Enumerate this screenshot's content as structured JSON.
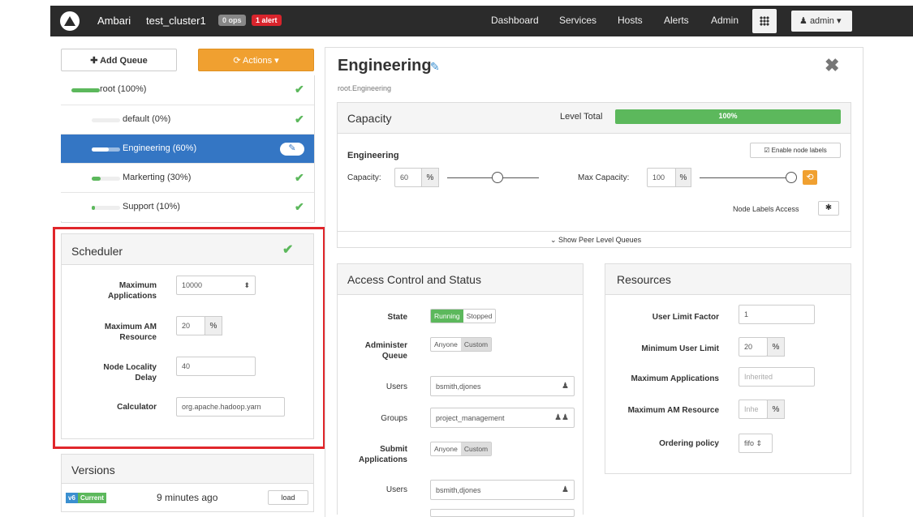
{
  "topbar": {
    "brand": "Ambari",
    "cluster": "test_cluster1",
    "ops_badge": "0 ops",
    "alert_badge": "1 alert",
    "nav": [
      "Dashboard",
      "Services",
      "Hosts",
      "Alerts",
      "Admin"
    ],
    "user_label": "admin ▾"
  },
  "left": {
    "add_queue": "✚ Add Queue",
    "actions": "⟳ Actions ▾",
    "queues": [
      {
        "label": "root (100%)",
        "percent": 100,
        "status": "ok"
      },
      {
        "label": "default (0%)",
        "percent": 0,
        "status": "ok"
      },
      {
        "label": "Engineering (60%)",
        "percent": 60,
        "status": "editing"
      },
      {
        "label": "Markerting (30%)",
        "percent": 30,
        "status": "ok"
      },
      {
        "label": "Support (10%)",
        "percent": 10,
        "status": "ok"
      }
    ]
  },
  "scheduler": {
    "title": "Scheduler",
    "max_apps_label": "Maximum Applications",
    "max_apps_value": "10000",
    "max_am_label": "Maximum AM Resource",
    "max_am_value": "20",
    "percent": "%",
    "node_locality_label": "Node Locality Delay",
    "node_locality_value": "40",
    "calculator_label": "Calculator",
    "calculator_value": "org.apache.hadoop.yarn"
  },
  "versions": {
    "title": "Versions",
    "tag_v": "v6",
    "tag_current": "Current",
    "time": "9 minutes ago",
    "load": "load"
  },
  "queue": {
    "title": "Engineering",
    "path": "root.Engineering"
  },
  "capacity": {
    "title": "Capacity",
    "level_total_label": "Level Total",
    "level_total_text": "100%",
    "level_total": 100,
    "queue_name": "Engineering",
    "enable_labels": "☑ Enable node labels",
    "capacity_label": "Capacity:",
    "capacity_value": "60",
    "capacity_level": 0.55,
    "max_capacity_label": "Max Capacity:",
    "max_capacity_value": "100",
    "max_capacity_level": 1.0,
    "percent": "%",
    "node_labels_access": "Node Labels Access",
    "show_peer": "⌄ Show Peer Level Queues"
  },
  "access": {
    "title": "Access Control and Status",
    "state_label": "State",
    "running": "Running",
    "stopped": "Stopped",
    "admin_label": "Administer Queue",
    "anyone": "Anyone",
    "custom": "Custom",
    "users_label": "Users",
    "users_value": "bsmith,djones",
    "groups_label": "Groups",
    "groups_value": "project_management",
    "submit_label": "Submit Applications",
    "users2_value": "bsmith,djones"
  },
  "resources": {
    "title": "Resources",
    "ulf_label": "User Limit Factor",
    "ulf_value": "1",
    "mul_label": "Minimum User Limit",
    "mul_value": "20",
    "percent": "%",
    "max_apps_label": "Maximum Applications",
    "max_apps_placeholder": "Inherited",
    "max_am_label": "Maximum AM Resource",
    "max_am_placeholder": "Inhe",
    "ordering_label": "Ordering policy",
    "ordering_value": "fifo ⇕"
  },
  "colors": {
    "accent": "#3476c4",
    "success": "#5cb85c",
    "orange": "#f0a030",
    "highlight": "#e0262b"
  }
}
